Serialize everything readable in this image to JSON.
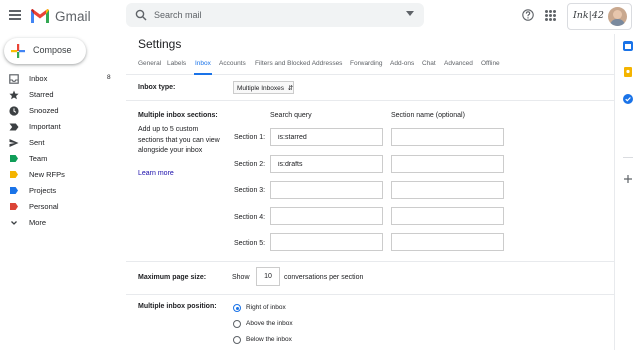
{
  "header": {
    "app_name": "Gmail",
    "search_placeholder": "Search mail",
    "brand_text": "Ink|42",
    "menu_icon": "hamburger-menu-icon",
    "help_icon": "help-circle-icon",
    "apps_icon": "apps-grid-icon"
  },
  "compose": {
    "label": "Compose"
  },
  "sidebar": {
    "items": [
      {
        "label": "Inbox",
        "count": "8",
        "icon": "inbox-icon"
      },
      {
        "label": "Starred",
        "icon": "star-icon"
      },
      {
        "label": "Snoozed",
        "icon": "clock-icon"
      },
      {
        "label": "Important",
        "icon": "important-icon"
      },
      {
        "label": "Sent",
        "icon": "send-icon"
      },
      {
        "label": "Team",
        "icon": "label-icon",
        "color": "#0f9d58"
      },
      {
        "label": "New RFPs",
        "icon": "label-icon",
        "color": "#f4b400"
      },
      {
        "label": "Projects",
        "icon": "label-icon",
        "color": "#1a73e8"
      },
      {
        "label": "Personal",
        "icon": "label-icon",
        "color": "#db4437"
      },
      {
        "label": "More",
        "icon": "chevron-down-icon"
      }
    ]
  },
  "settings": {
    "title": "Settings",
    "tabs": [
      "General",
      "Labels",
      "Inbox",
      "Accounts",
      "Filters and Blocked Addresses",
      "Forwarding",
      "Add-ons",
      "Chat",
      "Advanced",
      "Offline"
    ],
    "active_tab": "Inbox",
    "inbox_type": {
      "label": "Inbox type:",
      "value": "Multiple Inboxes"
    },
    "multiple_sections": {
      "label": "Multiple inbox sections:",
      "description": "Add up to 5 custom sections that you can view alongside your inbox",
      "learn_more": "Learn more",
      "col_query": "Search query",
      "col_name": "Section name (optional)",
      "sections": [
        {
          "label": "Section 1:",
          "query": "is:starred",
          "name": ""
        },
        {
          "label": "Section 2:",
          "query": "is:drafts",
          "name": ""
        },
        {
          "label": "Section 3:",
          "query": "",
          "name": ""
        },
        {
          "label": "Section 4:",
          "query": "",
          "name": ""
        },
        {
          "label": "Section 5:",
          "query": "",
          "name": ""
        }
      ]
    },
    "page_size": {
      "label": "Maximum page size:",
      "show": "Show",
      "value": "10",
      "suffix": "conversations per section"
    },
    "position": {
      "label": "Multiple inbox position:",
      "options": [
        {
          "label": "Right of inbox",
          "checked": true
        },
        {
          "label": "Above the inbox",
          "checked": false
        },
        {
          "label": "Below the inbox",
          "checked": false
        }
      ]
    }
  },
  "side_panel": {
    "icons": [
      {
        "name": "calendar-icon",
        "color": "#1a73e8"
      },
      {
        "name": "keep-icon",
        "color": "#f4b400"
      },
      {
        "name": "tasks-icon",
        "color": "#1a73e8"
      }
    ]
  }
}
